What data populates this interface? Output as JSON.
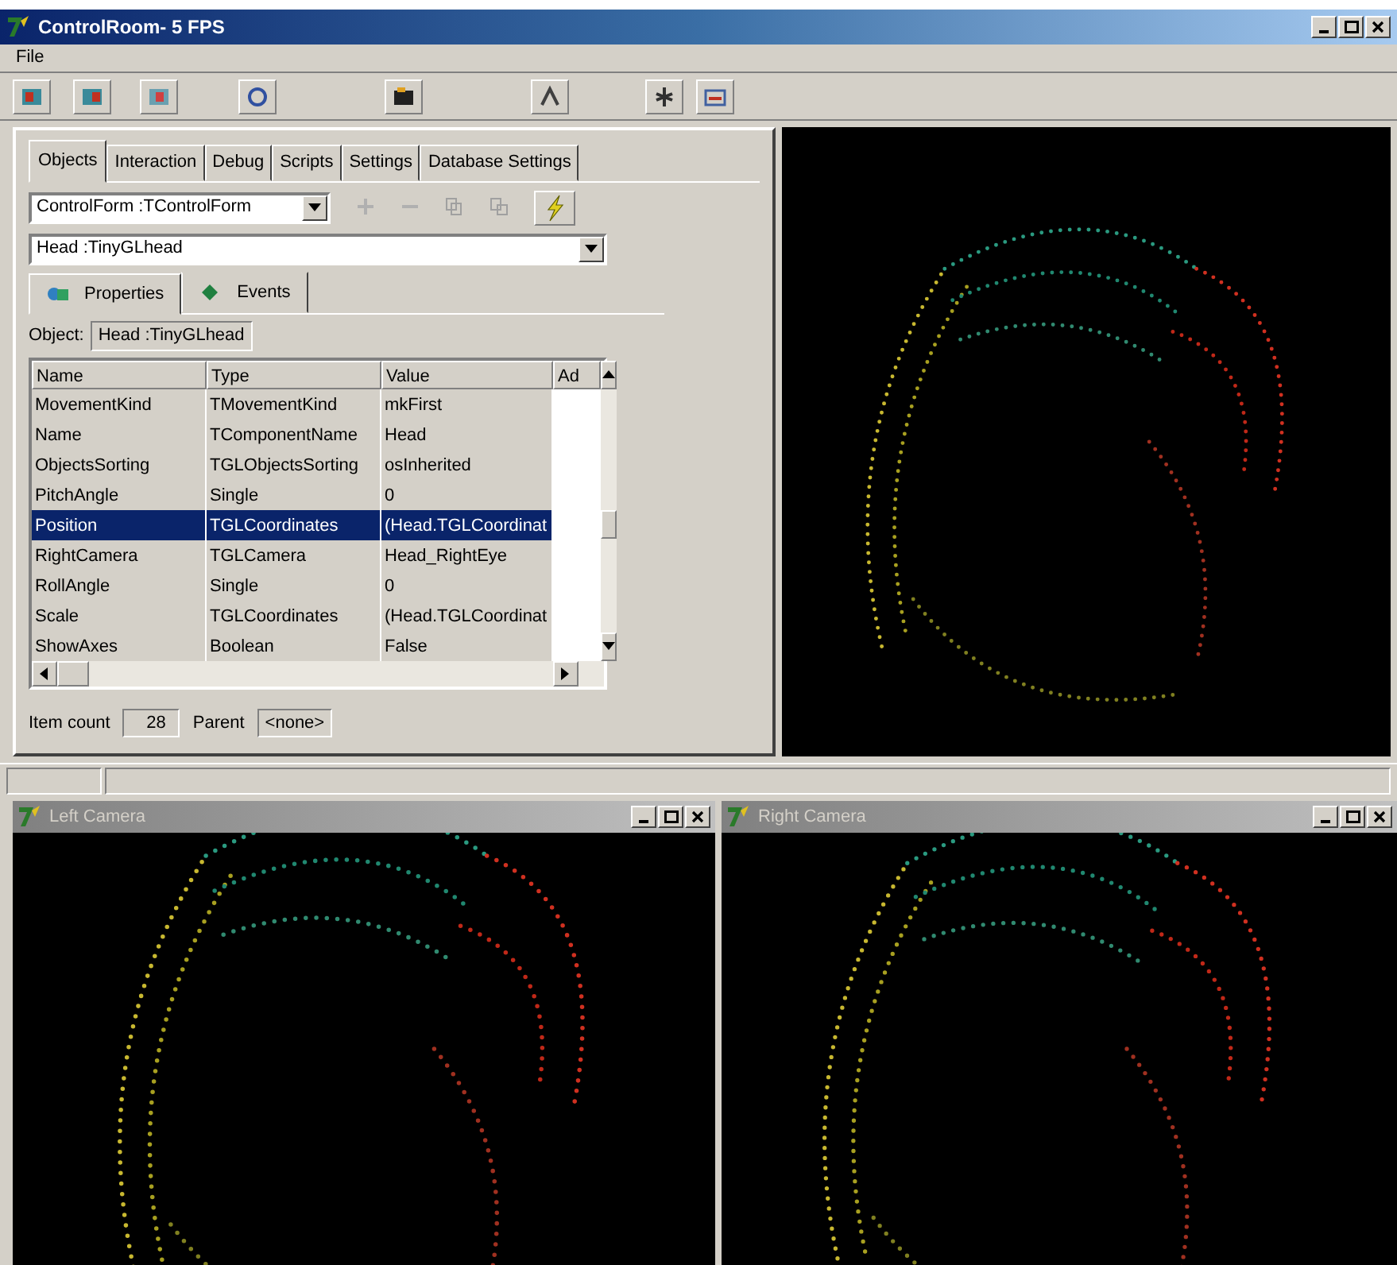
{
  "window": {
    "title": "ControlRoom- 5 FPS"
  },
  "menu": [
    "File"
  ],
  "tabs": [
    {
      "label": "Objects",
      "selected": true
    },
    {
      "label": "Interaction",
      "selected": false
    },
    {
      "label": "Debug",
      "selected": false
    },
    {
      "label": "Scripts",
      "selected": false
    },
    {
      "label": "Settings",
      "selected": false
    },
    {
      "label": "Database Settings",
      "selected": false
    }
  ],
  "form_select": {
    "value": "ControlForm :TControlForm"
  },
  "object_select": {
    "value": "Head :TinyGLhead"
  },
  "inspector_tabs": [
    {
      "label": "Properties",
      "selected": true
    },
    {
      "label": "Events",
      "selected": false
    }
  ],
  "object_label": "Object:",
  "object_value": "Head :TinyGLhead",
  "table": {
    "columns": [
      "Name",
      "Type",
      "Value",
      "Ad"
    ],
    "rows": [
      {
        "cells": [
          "MovementKind",
          "TMovementKind",
          "mkFirst"
        ],
        "selected": false
      },
      {
        "cells": [
          "Name",
          "TComponentName",
          "Head"
        ],
        "selected": false
      },
      {
        "cells": [
          "ObjectsSorting",
          "TGLObjectsSorting",
          "osInherited"
        ],
        "selected": false
      },
      {
        "cells": [
          "PitchAngle",
          "Single",
          "0"
        ],
        "selected": false
      },
      {
        "cells": [
          "Position",
          "TGLCoordinates",
          "(Head.TGLCoordinat"
        ],
        "selected": true
      },
      {
        "cells": [
          "RightCamera",
          "TGLCamera",
          "Head_RightEye"
        ],
        "selected": false
      },
      {
        "cells": [
          "RollAngle",
          "Single",
          "0"
        ],
        "selected": false
      },
      {
        "cells": [
          "Scale",
          "TGLCoordinates",
          "(Head.TGLCoordinat"
        ],
        "selected": false
      },
      {
        "cells": [
          "ShowAxes",
          "Boolean",
          "False"
        ],
        "selected": false
      }
    ]
  },
  "footer": {
    "count_label": "Item count",
    "count": "28",
    "parent_label": "Parent",
    "parent": "<none>"
  },
  "child_windows": [
    {
      "title": "Left Camera"
    },
    {
      "title": "Right Camera"
    }
  ]
}
